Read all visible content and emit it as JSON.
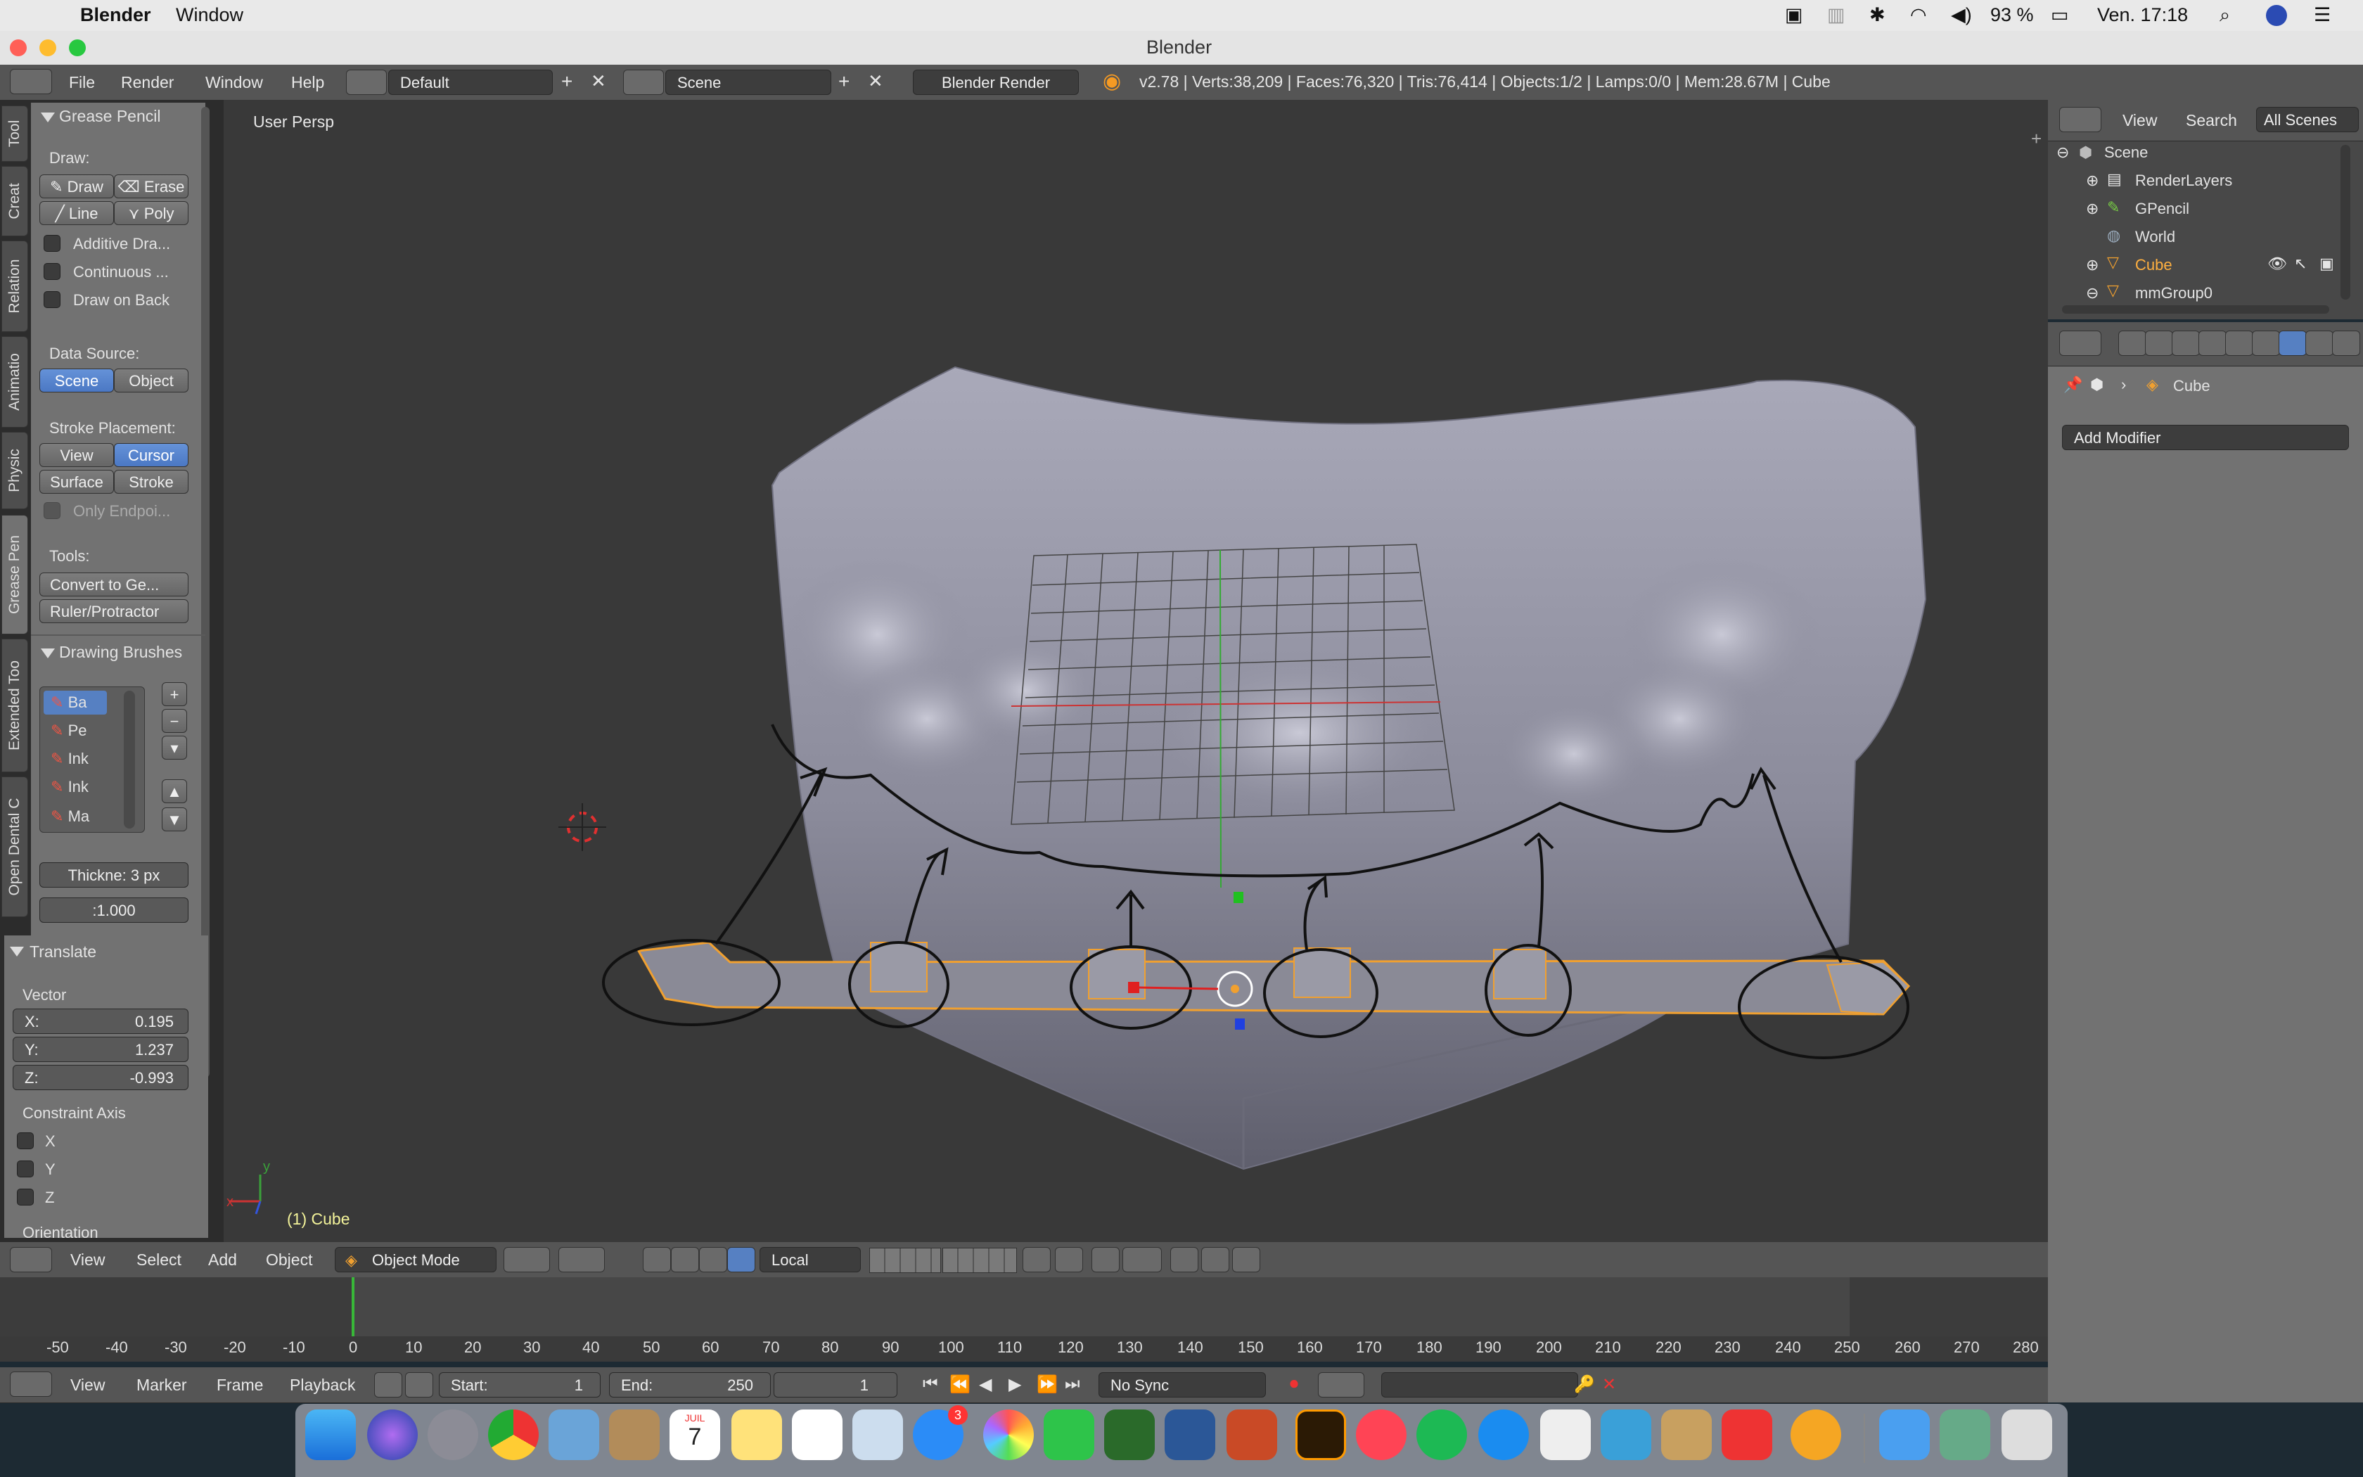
{
  "mac_menubar": {
    "app_name": "Blender",
    "menu_window": "Window",
    "battery": "93 %",
    "clock": "Ven. 17:18"
  },
  "window": {
    "title": "Blender"
  },
  "info_header": {
    "menus": [
      "File",
      "Render",
      "Window",
      "Help"
    ],
    "screen_layout": "Default",
    "scene": "Scene",
    "render_engine": "Blender Render",
    "stats": "v2.78 | Verts:38,209 | Faces:76,320 | Tris:76,414 | Objects:1/2 | Lamps:0/0 | Mem:28.67M | Cube"
  },
  "tool_shelf": {
    "tabs": [
      "Tool",
      "Creat",
      "Relation",
      "Animatio",
      "Physic",
      "Grease Pen",
      "Extended Too",
      "Open Dental C"
    ],
    "grease_pencil": {
      "title": "Grease Pencil",
      "draw_label": "Draw:",
      "draw": "Draw",
      "erase": "Erase",
      "line": "Line",
      "poly": "Poly",
      "additive": "Additive Dra...",
      "continuous": "Continuous ...",
      "draw_on_back": "Draw on Back",
      "data_source_label": "Data Source:",
      "scene": "Scene",
      "object": "Object",
      "stroke_placement_label": "Stroke Placement:",
      "view": "View",
      "cursor": "Cursor",
      "surface": "Surface",
      "stroke": "Stroke",
      "only_endpoints": "Only Endpoi...",
      "tools_label": "Tools:",
      "convert": "Convert to Ge...",
      "ruler": "Ruler/Protractor"
    },
    "drawing_brushes": {
      "title": "Drawing Brushes",
      "brushes": [
        "Ba",
        "Pe",
        "Ink",
        "Ink",
        "Ma"
      ],
      "thickness": "Thickne: 3 px",
      "strength": ":1.000"
    },
    "translate": {
      "title": "Translate",
      "vector_label": "Vector",
      "x": "X:",
      "x_val": "0.195",
      "y": "Y:",
      "y_val": "1.237",
      "z": "Z:",
      "z_val": "-0.993",
      "constraint_label": "Constraint Axis",
      "cx": "X",
      "cy": "Y",
      "cz": "Z",
      "orientation_label": "Orientation"
    }
  },
  "viewport": {
    "view_label": "User Persp",
    "object_label": "(1) Cube",
    "axis_x": "x",
    "axis_y": "y"
  },
  "view3d_header": {
    "menus": [
      "View",
      "Select",
      "Add",
      "Object"
    ],
    "mode": "Object Mode",
    "orientation": "Local"
  },
  "timeline": {
    "ticks": [
      "-50",
      "-40",
      "-30",
      "-20",
      "-10",
      "0",
      "10",
      "20",
      "30",
      "40",
      "50",
      "60",
      "70",
      "80",
      "90",
      "100",
      "110",
      "120",
      "130",
      "140",
      "150",
      "160",
      "170",
      "180",
      "190",
      "200",
      "210",
      "220",
      "230",
      "240",
      "250",
      "260",
      "270",
      "280"
    ],
    "current_frame": 1,
    "menus": [
      "View",
      "Marker",
      "Frame",
      "Playback"
    ],
    "start": "Start:",
    "start_val": "1",
    "end": "End:",
    "end_val": "250",
    "frame_val": "1",
    "sync": "No Sync"
  },
  "outliner": {
    "menus": [
      "View",
      "Search"
    ],
    "filter": "All Scenes",
    "items": [
      "Scene",
      "RenderLayers",
      "GPencil",
      "World",
      "Cube",
      "mmGroup0"
    ]
  },
  "properties": {
    "breadcrumb": "Cube",
    "add_modifier": "Add Modifier"
  },
  "dock": {
    "calendar_month": "JUIL",
    "calendar_day": "7",
    "messages_badge": "3"
  },
  "colors": {
    "active_blue": "#5680c2",
    "selection_orange": "#f0a030",
    "panel_bg": "#727272",
    "viewport_bg": "#3a3a3a",
    "header_bg": "#555555"
  }
}
